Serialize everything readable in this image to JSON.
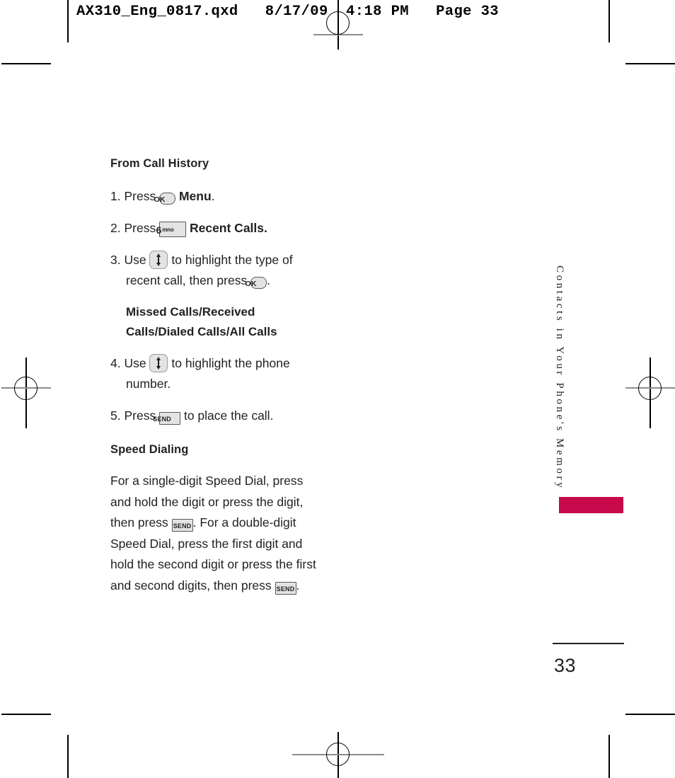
{
  "print_header": "AX310_Eng_0817.qxd   8/17/09  4:18 PM   Page 33",
  "content": {
    "heading_1": "From Call History",
    "steps": [
      {
        "number": "1.",
        "pre": "Press",
        "key": "OK",
        "post_bold": "Menu",
        "post": "."
      },
      {
        "number": "2.",
        "pre": "Press",
        "key_digit": "6",
        "key_letters": "mno",
        "post_bold": "Recent Calls.",
        "post": ""
      },
      {
        "number": "3.",
        "pre": "Use",
        "key": "navigation",
        "mid": "to highlight the type of recent call, then press",
        "key2": "OK",
        "post": "."
      },
      {
        "number": "4.",
        "pre": "Use",
        "key": "navigation",
        "mid": "to highlight the phone number.",
        "post": ""
      },
      {
        "number": "5.",
        "pre": "Press",
        "key": "SEND",
        "mid": "to place the call.",
        "post": ""
      }
    ],
    "call_types": "Missed Calls/Received Calls/Dialed Calls/All Calls",
    "heading_2": "Speed Dialing",
    "speed_dial_p1": "For a single-digit Speed Dial, press and hold the digit or press the digit, then press",
    "speed_dial_p2": ". For a double-digit Speed Dial, press the first digit and hold the second digit or press the first and second digits, then press",
    "speed_dial_p3": "."
  },
  "keys": {
    "ok_label": "OK",
    "send_label": "SEND",
    "six_digit": "6",
    "six_letters": "mno"
  },
  "side": {
    "running_head": "Contacts in Your Phone's Memory",
    "tab_color": "#c8094b"
  },
  "footer": {
    "page_number": "33"
  }
}
